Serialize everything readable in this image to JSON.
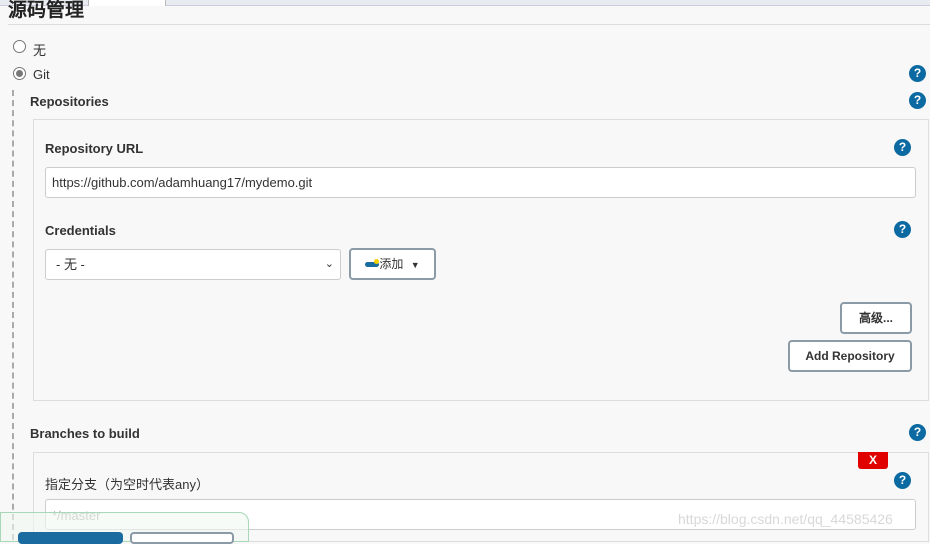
{
  "section_title": "源码管理",
  "scm_options": [
    {
      "label": "无",
      "selected": false
    },
    {
      "label": "Git",
      "selected": true
    }
  ],
  "repositories": {
    "label": "Repositories",
    "url_label": "Repository URL",
    "url_value": "https://github.com/adamhuang17/mydemo.git",
    "credentials_label": "Credentials",
    "credentials_value": "- 无 -",
    "add_label": "添加",
    "advanced_label": "高级...",
    "add_repository_label": "Add Repository"
  },
  "branches": {
    "label": "Branches to build",
    "delete_label": "X",
    "specifier_label": "指定分支（为空时代表any）",
    "specifier_value": "*/master"
  },
  "help_icon": "?",
  "watermark": "https://blog.csdn.net/qq_44585426",
  "colors": {
    "help": "#0b6aa2",
    "delete": "#e00000",
    "primary": "#1a6ca0"
  }
}
